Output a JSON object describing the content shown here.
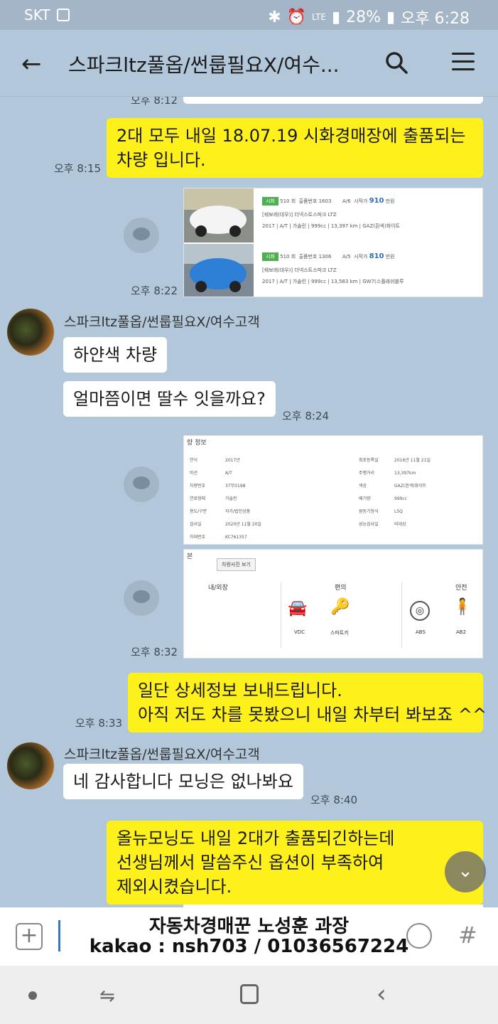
{
  "status_bar": {
    "carrier": "SKT",
    "battery": "28%",
    "time": "오후 6:28",
    "network": "LTE"
  },
  "app_bar": {
    "back_icon": "arrow-left-icon",
    "title": "스파크ltz풀옵/썬룹필요X/여수...",
    "search_icon": "search-icon",
    "menu_icon": "hamburger-icon"
  },
  "messages": {
    "top_time_partial": "오후 8:12",
    "m1": {
      "text": "2대 모두 내일 18.07.19 시화경매장에 출품되는\n차량 입니다.",
      "time": "오후 8:15"
    },
    "m2": {
      "time": "오후 8:22",
      "listings": [
        {
          "site": "시화",
          "no": "510 회",
          "exhibit": "출품번호 1603",
          "grade": "A/6",
          "start": "시작가",
          "price": "910",
          "unit": "만원",
          "name": "[쉐보레(대우)] 더넥스트스파크 LTZ",
          "detail": "2017 | A/T | 가솔린 | 999cc | 13,397 km | GAZ(흰색)화이트"
        },
        {
          "site": "시화",
          "no": "510 회",
          "exhibit": "출품번호 1306",
          "grade": "A/5",
          "start": "시작가",
          "price": "810",
          "unit": "만원",
          "name": "[쉐보레(대우)] 더넥스트스파크 LTZ",
          "detail": "2017 | A/T | 가솔린 | 999cc | 13,583 km | GW7(스플래쉬블루"
        }
      ]
    },
    "sender_name": "스파크ltz풀옵/썬룹필요X/여수고객",
    "m3": {
      "text": "하얀색 차량"
    },
    "m4": {
      "text": "얼마쯤이면 딸수 잇을까요?",
      "time": "오후 8:24"
    },
    "m5": {
      "spec_title": "량 정보",
      "left_col": "연식\n미션\n차량번호\n연료형태\n용도/구분\n검사일\n차대번호",
      "left_val": "2017년\nA/T\n37무0198\n가솔린\n자가/법인상품\n2020년 11월 20일\nKC761357",
      "right_col": "최초등록일\n주행거리\n색상\n배기량\n원동기형식\n성능검사일",
      "right_val": "2016년 11월 21일\n13,397km\nGAZ(흰색)화이트\n999cc\nL5Q\n비대상",
      "btn": "차량사진 보기",
      "sections": [
        "내/외장",
        "편의",
        "안전"
      ],
      "options": [
        "VDC",
        "스마트키",
        "ABS",
        "AB2"
      ],
      "time": "오후 8:32",
      "head_partial": "본"
    },
    "m6": {
      "text": "일단 상세정보 보내드립니다.\n아직 저도 차를 못봤으니 내일 차부터 봐보죠 ^^",
      "time": "오후 8:33"
    },
    "m7": {
      "text": "네 감사합니다 모닝은 없나봐요",
      "time": "오후 8:40"
    },
    "m8": {
      "text": "올뉴모닝도 내일 2대가 출품되긴하는데\n선생님께서 말씀주신 옵션이 부족하여\n제외시켰습니다."
    }
  },
  "input_bar": {
    "caption_line1": "자동차경매꾼 노성훈 과장",
    "caption_line2": "kakao : nsh703 / 01036567224"
  },
  "colors": {
    "chat_bg": "#b2c7d9",
    "my_bubble": "#fef01b",
    "their_bubble": "#ffffff"
  }
}
